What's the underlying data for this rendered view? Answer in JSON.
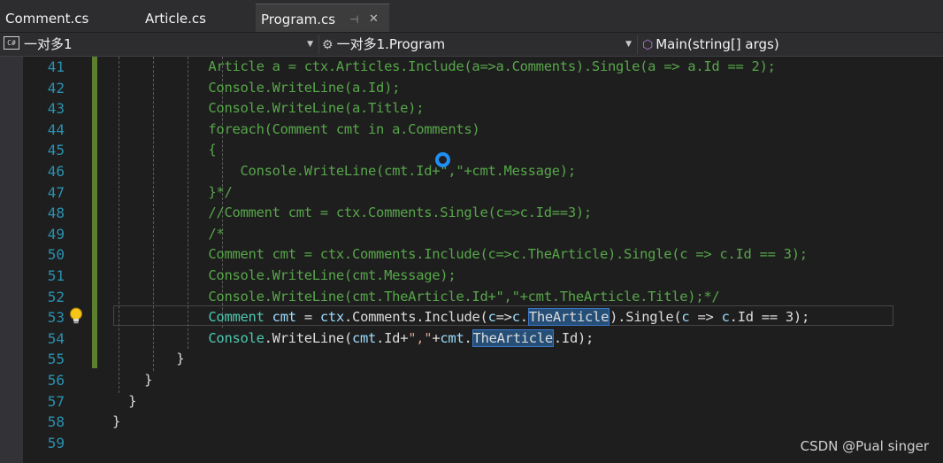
{
  "tabs": [
    {
      "label": "Comment.cs",
      "active": false
    },
    {
      "label": "Article.cs",
      "active": false
    },
    {
      "label": "Program.cs",
      "active": true,
      "pin_icon": "⊣",
      "close_icon": "✕"
    }
  ],
  "navbar": {
    "project": {
      "badge": "C#",
      "label": "一对多1"
    },
    "class": {
      "label": "一对多1.Program"
    },
    "member": {
      "label": "Main(string[] args)"
    },
    "dropdown_arrow": "▼"
  },
  "editor": {
    "lines": [
      {
        "num": "41",
        "tokens": [
          {
            "t": "            Article a = ctx.Articles.Include(a=>a.Comments).Single(a => a.Id == 2);",
            "c": "cm"
          }
        ]
      },
      {
        "num": "42",
        "tokens": [
          {
            "t": "            Console.WriteLine(a.Id);",
            "c": "cm"
          }
        ]
      },
      {
        "num": "43",
        "tokens": [
          {
            "t": "            Console.WriteLine(a.Title);",
            "c": "cm"
          }
        ]
      },
      {
        "num": "44",
        "tokens": [
          {
            "t": "            foreach(Comment cmt in a.Comments)",
            "c": "cm"
          }
        ]
      },
      {
        "num": "45",
        "tokens": [
          {
            "t": "            {",
            "c": "cm"
          }
        ]
      },
      {
        "num": "46",
        "tokens": [
          {
            "t": "                Console.WriteLine(cmt.Id+\",\"+cmt.Message);",
            "c": "cm"
          }
        ]
      },
      {
        "num": "47",
        "tokens": [
          {
            "t": "            }*/",
            "c": "cm"
          }
        ]
      },
      {
        "num": "48",
        "tokens": [
          {
            "t": "            //Comment cmt = ctx.Comments.Single(c=>c.Id==3);",
            "c": "cm"
          }
        ]
      },
      {
        "num": "49",
        "tokens": [
          {
            "t": "            /*",
            "c": "cm"
          }
        ]
      },
      {
        "num": "50",
        "tokens": [
          {
            "t": "            Comment cmt = ctx.Comments.Include(c=>c.TheArticle).Single(c => c.Id == 3);",
            "c": "cm"
          }
        ]
      },
      {
        "num": "51",
        "tokens": [
          {
            "t": "            Console.WriteLine(cmt.Message);",
            "c": "cm"
          }
        ]
      },
      {
        "num": "52",
        "tokens": [
          {
            "t": "            Console.WriteLine(cmt.TheArticle.Id+\",\"+cmt.TheArticle.Title);*/",
            "c": "cm"
          }
        ]
      },
      {
        "num": "53",
        "tokens": [
          {
            "t": "            ",
            "c": "pl"
          },
          {
            "t": "Comment",
            "c": "ty"
          },
          {
            "t": " ",
            "c": "pl"
          },
          {
            "t": "cmt",
            "c": "vl"
          },
          {
            "t": " = ",
            "c": "pl"
          },
          {
            "t": "ctx",
            "c": "vl"
          },
          {
            "t": ".Comments.Include(",
            "c": "pl"
          },
          {
            "t": "c",
            "c": "vl"
          },
          {
            "t": "=>",
            "c": "pl"
          },
          {
            "t": "c",
            "c": "vl"
          },
          {
            "t": ".",
            "c": "pl"
          },
          {
            "t": "TheArticle",
            "c": "pl hl"
          },
          {
            "t": ").Single(",
            "c": "pl"
          },
          {
            "t": "c",
            "c": "vl"
          },
          {
            "t": " => ",
            "c": "pl"
          },
          {
            "t": "c",
            "c": "vl"
          },
          {
            "t": ".Id == 3);",
            "c": "pl"
          }
        ]
      },
      {
        "num": "54",
        "tokens": [
          {
            "t": "            ",
            "c": "pl"
          },
          {
            "t": "Console",
            "c": "ty"
          },
          {
            "t": ".WriteLine(",
            "c": "pl"
          },
          {
            "t": "cmt",
            "c": "vl"
          },
          {
            "t": ".Id+",
            "c": "pl"
          },
          {
            "t": "\",\"",
            "c": "st"
          },
          {
            "t": "+",
            "c": "pl"
          },
          {
            "t": "cmt",
            "c": "vl"
          },
          {
            "t": ".",
            "c": "pl"
          },
          {
            "t": "TheArticle",
            "c": "pl hl"
          },
          {
            "t": ".Id);",
            "c": "pl"
          }
        ]
      },
      {
        "num": "55",
        "tokens": [
          {
            "t": "        }",
            "c": "pl"
          }
        ]
      },
      {
        "num": "56",
        "tokens": [
          {
            "t": "    }",
            "c": "pl"
          }
        ]
      },
      {
        "num": "57",
        "tokens": [
          {
            "t": "  }",
            "c": "pl"
          }
        ]
      },
      {
        "num": "58",
        "tokens": [
          {
            "t": "}",
            "c": "pl"
          }
        ]
      },
      {
        "num": "59",
        "tokens": []
      }
    ],
    "current_line": "53",
    "lightbulb_line": "53"
  },
  "watermark": "CSDN @Pual singer",
  "colors": {
    "background": "#1e1e1e",
    "comment": "#57a64a",
    "type": "#4ec9b0",
    "line_number": "#2b91af",
    "highlight": "#264f78"
  }
}
